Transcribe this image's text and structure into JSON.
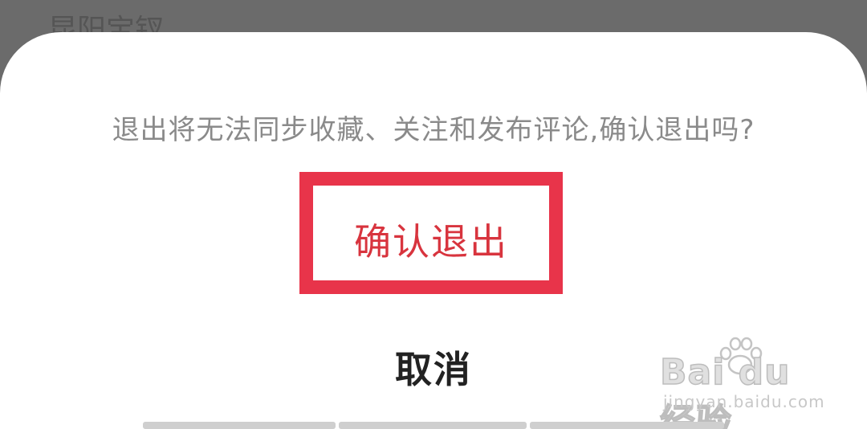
{
  "background": {
    "partial_title": "昆阳宝钗"
  },
  "dialog": {
    "message": "退出将无法同步收藏、关注和发布评论,确认退出吗?",
    "confirm_label": "确认退出",
    "cancel_label": "取消"
  },
  "colors": {
    "overlay": "#6b6b6b",
    "sheet": "#ffffff",
    "highlight_border": "#e8344a",
    "confirm_text": "#d8343e",
    "message_text": "#8a8a8a",
    "cancel_text": "#222222"
  },
  "watermark": {
    "logo_text": "Bai du 经验",
    "url": "jingyan.baidu.com"
  }
}
